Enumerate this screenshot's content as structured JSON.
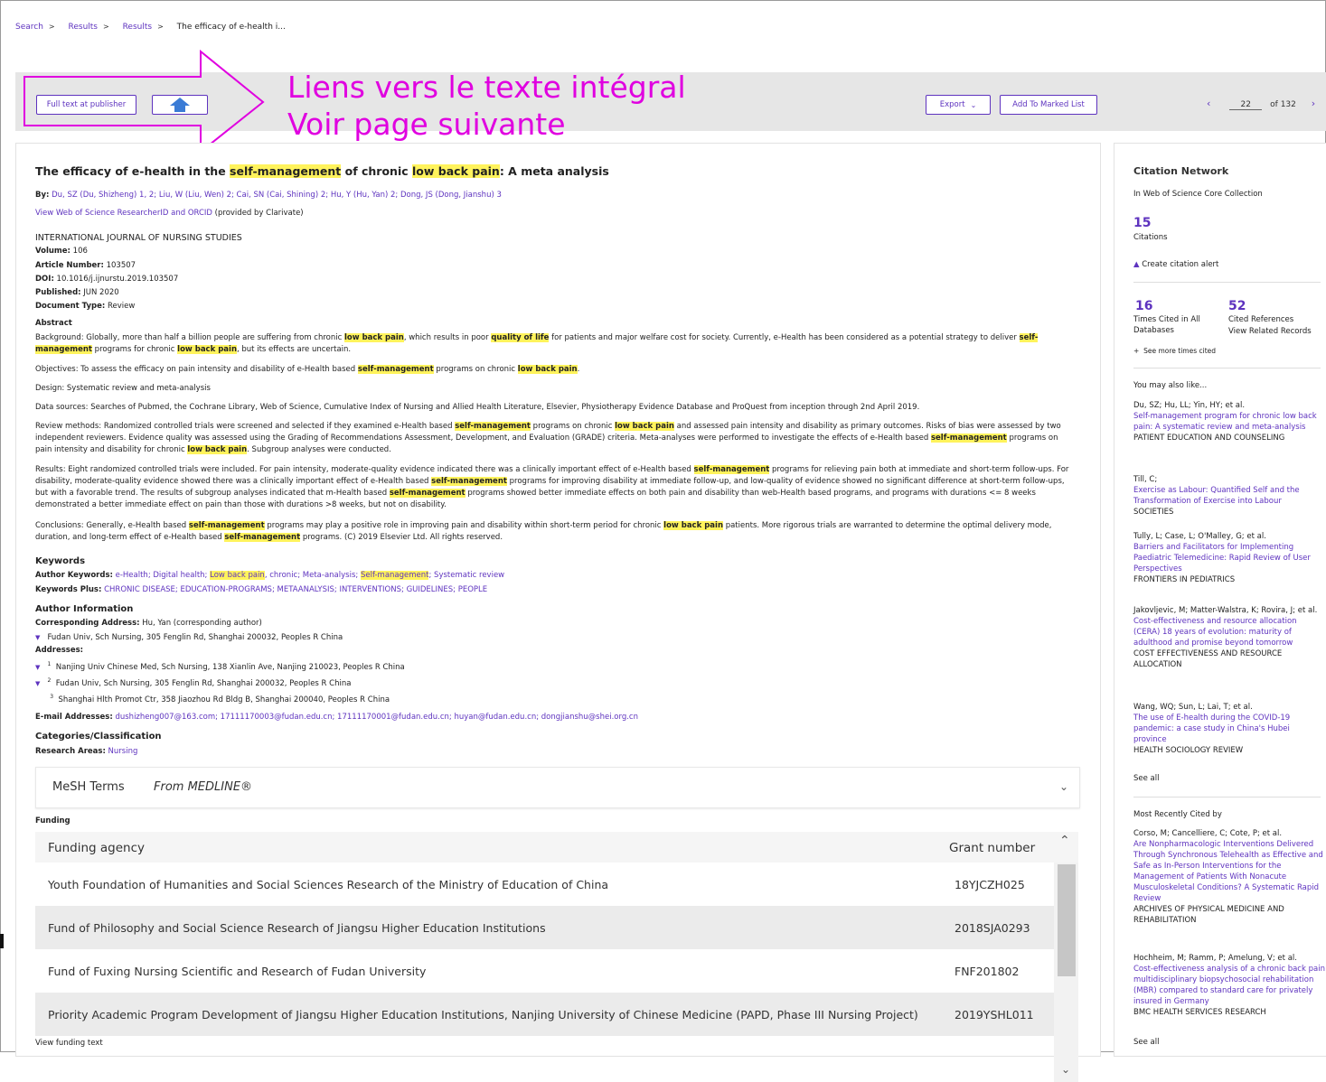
{
  "breadcrumb": {
    "search": "Search",
    "results1": "Results",
    "results2": "Results",
    "current": "The efficacy of e-health i..."
  },
  "toolbar": {
    "full_text": "Full text at publisher",
    "export": "Export",
    "add_marked": "Add To Marked List",
    "page": "22",
    "page_total": "of 132"
  },
  "annotation": {
    "line1": "Liens vers le texte intégral",
    "line2": "Voir page suivante"
  },
  "record": {
    "title_1": "The efficacy of e-health in the ",
    "title_hl1": "self-management",
    "title_2": " of chronic ",
    "title_hl2": "low back pain",
    "title_3": ": A meta analysis",
    "by_label": "By:",
    "authors": "Du, SZ (Du, Shizheng) 1, 2; Liu, W (Liu, Wen) 2; Cai, SN (Cai, Shining) 2; Hu, Y (Hu, Yan) 2; Dong, JS (Dong, Jianshu) 3",
    "orcid_link": "View Web of Science ResearcherID and ORCID",
    "orcid_note": " (provided by Clarivate)",
    "journal": "INTERNATIONAL JOURNAL OF NURSING STUDIES",
    "volume_label": "Volume:",
    "volume": "106",
    "article_label": "Article Number:",
    "article": "103507",
    "doi_label": "DOI:",
    "doi": "10.1016/j.ijnurstu.2019.103507",
    "published_label": "Published:",
    "published": "JUN 2020",
    "doctype_label": "Document Type:",
    "doctype": "Review",
    "abstract_label": "Abstract",
    "bg_1": "Background: Globally, more than half a billion people are suffering from chronic ",
    "bg_hl1": "low back pain",
    "bg_2": ", which results in poor ",
    "bg_hl2": "quality of life",
    "bg_3": " for patients and major welfare cost for society. Currently, e-Health has been considered as a potential strategy to deliver ",
    "bg_hl3": "self-management",
    "bg_4": " programs for chronic ",
    "bg_hl4": "low back pain",
    "bg_5": ", but its effects are uncertain.",
    "obj_1": "Objectives: To assess the efficacy on pain intensity and disability of e-Health based ",
    "obj_hl1": "self-management",
    "obj_2": " programs on chronic ",
    "obj_hl2": "low back pain",
    "obj_3": ".",
    "design": "Design: Systematic review and meta-analysis",
    "sources": "Data sources: Searches of Pubmed, the Cochrane Library, Web of Science, Cumulative Index of Nursing and Allied Health Literature, Elsevier, Physiotherapy Evidence Database and ProQuest from inception through 2nd April 2019.",
    "rm_1": "Review methods: Randomized controlled trials were screened and selected if they examined e-Health based ",
    "rm_hl1": "self-management",
    "rm_2": " programs on chronic ",
    "rm_hl2": "low back pain",
    "rm_3": " and assessed pain intensity and disability as primary outcomes. Risks of bias were assessed by two independent reviewers. Evidence quality was assessed using the Grading of Recommendations Assessment, Development, and Evaluation (GRADE) criteria. Meta-analyses were performed to investigate the effects of e-Health based ",
    "rm_hl3": "self-management",
    "rm_4": " programs on pain intensity and disability for chronic ",
    "rm_hl4": "low back pain",
    "rm_5": ". Subgroup analyses were conducted.",
    "res_1": "Results: Eight randomized controlled trials were included. For pain intensity, moderate-quality evidence indicated there was a clinically important effect of e-Health based ",
    "res_hl1": "self-management",
    "res_2": " programs for relieving pain both at immediate and short-term follow-ups. For disability, moderate-quality evidence showed there was a clinically important effect of e-Health based ",
    "res_hl2": "self-management",
    "res_3": " programs for improving disability at immediate follow-up, and low-quality of evidence showed no significant difference at short-term follow-ups, but with a favorable trend. The results of subgroup analyses indicated that m-Health based ",
    "res_hl3": "self-management",
    "res_4": " programs showed better immediate effects on both pain and disability than web-Health based programs, and programs with durations <= 8 weeks demonstrated a better immediate effect on pain than those with durations >8 weeks, but not on disability.",
    "con_1": "Conclusions: Generally, e-Health based ",
    "con_hl1": "self-management",
    "con_2": " programs may play a positive role in improving pain and disability within short-term period for chronic ",
    "con_hl2": "low back pain",
    "con_3": " patients. More rigorous trials are warranted to determine the optimal delivery mode, duration, and long-term effect of e-Health based ",
    "con_hl3": "self-management",
    "con_4": " programs. (C) 2019 Elsevier Ltd. All rights reserved.",
    "kw_label": "Keywords",
    "akw_label": "Author Keywords:",
    "akw_1": "e-Health; Digital health; ",
    "akw_hl1": "Low back pain",
    "akw_2": ", chronic; Meta-analysis; ",
    "akw_hl2": "Self-management",
    "akw_3": "; Systematic review",
    "kwp_label": "Keywords Plus:",
    "kwp": "CHRONIC DISEASE; EDUCATION-PROGRAMS; METAANALYSIS; INTERVENTIONS; GUIDELINES; PEOPLE",
    "ai_label": "Author Information",
    "corr_label": "Corresponding Address:",
    "corr": "Hu, Yan (corresponding author)",
    "corr_addr": "Fudan Univ, Sch Nursing, 305 Fenglin Rd, Shanghai 200032, Peoples R China",
    "addr_label": "Addresses:",
    "addr1": "Nanjing Univ Chinese Med, Sch Nursing, 138 Xianlin Ave, Nanjing 210023, Peoples R China",
    "addr2": "Fudan Univ, Sch Nursing, 305 Fenglin Rd, Shanghai 200032, Peoples R China",
    "addr3": "Shanghai Hlth Promot Ctr, 358 Jiaozhou Rd Bldg B, Shanghai 200040, Peoples R China",
    "email_label": "E-mail Addresses:",
    "emails": "dushizheng007@163.com; 17111170003@fudan.edu.cn; 17111170001@fudan.edu.cn; huyan@fudan.edu.cn; dongjianshu@shei.org.cn",
    "cat_label": "Categories/Classification",
    "ra_label": "Research Areas:",
    "ra": "Nursing",
    "mesh_label": "MeSH Terms",
    "mesh_from": "From MEDLINE®",
    "funding_label": "Funding",
    "funding_head_agency": "Funding agency",
    "funding_head_grant": "Grant number",
    "funding": [
      {
        "agency": "Youth Foundation of Humanities and Social Sciences Research of the Ministry of Education of China",
        "grant": "18YJCZH025"
      },
      {
        "agency": "Fund of Philosophy and Social Science Research of Jiangsu Higher Education Institutions",
        "grant": "2018SJA0293"
      },
      {
        "agency": "Fund of Fuxing Nursing Scientific and Research of Fudan University",
        "grant": "FNF201802"
      },
      {
        "agency": "Priority Academic Program Development of Jiangsu Higher Education Institutions, Nanjing University of Chinese Medicine (PAPD, Phase III Nursing Project)",
        "grant": "2019YSHL011"
      }
    ],
    "view_funding": "View funding text"
  },
  "side": {
    "cn_title": "Citation Network",
    "cn_sub": "In Web of Science Core Collection",
    "citations": "15",
    "citations_label": "Citations",
    "alert": "Create citation alert",
    "times": "16",
    "times_label": "Times Cited in All Databases",
    "refs": "52",
    "refs_label": "Cited References",
    "related": "View Related Records",
    "more_times": "See more times cited",
    "like_title": "You may also like...",
    "likes": [
      {
        "authors": "Du, SZ; Hu, LL; Yin, HY; et al.",
        "title": "Self-management program for chronic low back pain: A systematic review and meta-analysis",
        "journal": "PATIENT EDUCATION AND COUNSELING"
      },
      {
        "authors": "Till, C;",
        "title": "Exercise as Labour: Quantified Self and the Transformation of Exercise into Labour",
        "journal": "SOCIETIES"
      },
      {
        "authors": "Tully, L; Case, L; O'Malley, G; et al.",
        "title": "Barriers and Facilitators for Implementing Paediatric Telemedicine: Rapid Review of User Perspectives",
        "journal": "FRONTIERS IN PEDIATRICS"
      },
      {
        "authors": "Jakovljevic, M; Matter-Walstra, K; Rovira, J; et al.",
        "title": "Cost-effectiveness and resource allocation (CERA) 18 years of evolution: maturity of adulthood and promise beyond tomorrow",
        "journal": "COST EFFECTIVENESS AND RESOURCE ALLOCATION"
      },
      {
        "authors": "Wang, WQ; Sun, L; Lai, T; et al.",
        "title": "The use of E-health during the COVID-19 pandemic: a case study in China's Hubei province",
        "journal": "HEALTH SOCIOLOGY REVIEW"
      }
    ],
    "see_all": "See all",
    "recent_title": "Most Recently Cited by",
    "recent": [
      {
        "authors": "Corso, M; Cancelliere, C; Cote, P; et al.",
        "title": "Are Nonpharmacologic Interventions Delivered Through Synchronous Telehealth as Effective and Safe as In-Person Interventions for the Management of Patients With Nonacute Musculoskeletal Conditions? A Systematic Rapid Review",
        "journal": "ARCHIVES OF PHYSICAL MEDICINE AND REHABILITATION"
      },
      {
        "authors": "Hochheim, M; Ramm, P; Amelung, V; et al.",
        "title": "Cost-effectiveness analysis of a chronic back pain multidisciplinary biopsychosocial rehabilitation (MBR) compared to standard care for privately insured in Germany",
        "journal": "BMC HEALTH SERVICES RESEARCH"
      }
    ],
    "see_all2": "See all"
  }
}
